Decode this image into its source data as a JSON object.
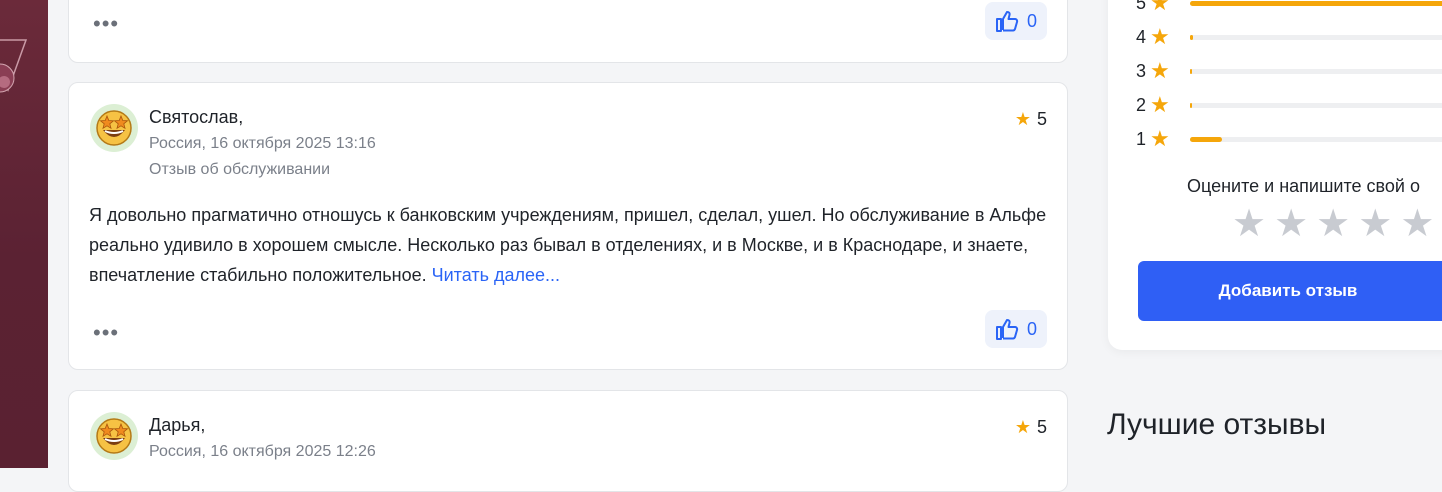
{
  "reviews": [
    {
      "author": "",
      "meta_line1": "",
      "meta_line2": "",
      "rating": "",
      "text": "",
      "read_more": "",
      "more_dots": "•••",
      "likes": "0"
    },
    {
      "author": "Святослав,",
      "meta_line1": "Россия, 16 октября 2025 13:16",
      "meta_line2": "Отзыв об обслуживании",
      "rating": "5",
      "text": "Я довольно прагматично отношусь к банковским учреждениям, пришел, сделал, ушел. Но обслуживание в Альфе реально удивило в хорошем смысле. Несколько раз бывал в отделениях, и в Москве, и в Краснодаре, и знаете, впечатление стабильно положительное. ",
      "read_more": "Читать далее...",
      "more_dots": "•••",
      "likes": "0"
    },
    {
      "author": "Дарья,",
      "meta_line1": "Россия, 16 октября 2025 12:26",
      "rating": "5"
    }
  ],
  "rating_summary": {
    "rows": [
      {
        "stars": "5",
        "share": 1.0
      },
      {
        "stars": "4",
        "share": 0.01
      },
      {
        "stars": "3",
        "share": 0.005
      },
      {
        "stars": "2",
        "share": 0.005
      },
      {
        "stars": "1",
        "share": 0.12
      }
    ],
    "prompt": "Оцените и напишите свой о",
    "add_button": "Добавить отзыв"
  },
  "best_reviews_title": "Лучшие отзывы",
  "colors": {
    "accent": "#2f5ff5",
    "star": "#f5a60a",
    "link": "#2a64f6"
  },
  "icons": {
    "like": "thumbs-up-icon",
    "more": "more-dots-icon",
    "rating": "star-icon",
    "avatar": "star-struck-emoji-icon"
  }
}
